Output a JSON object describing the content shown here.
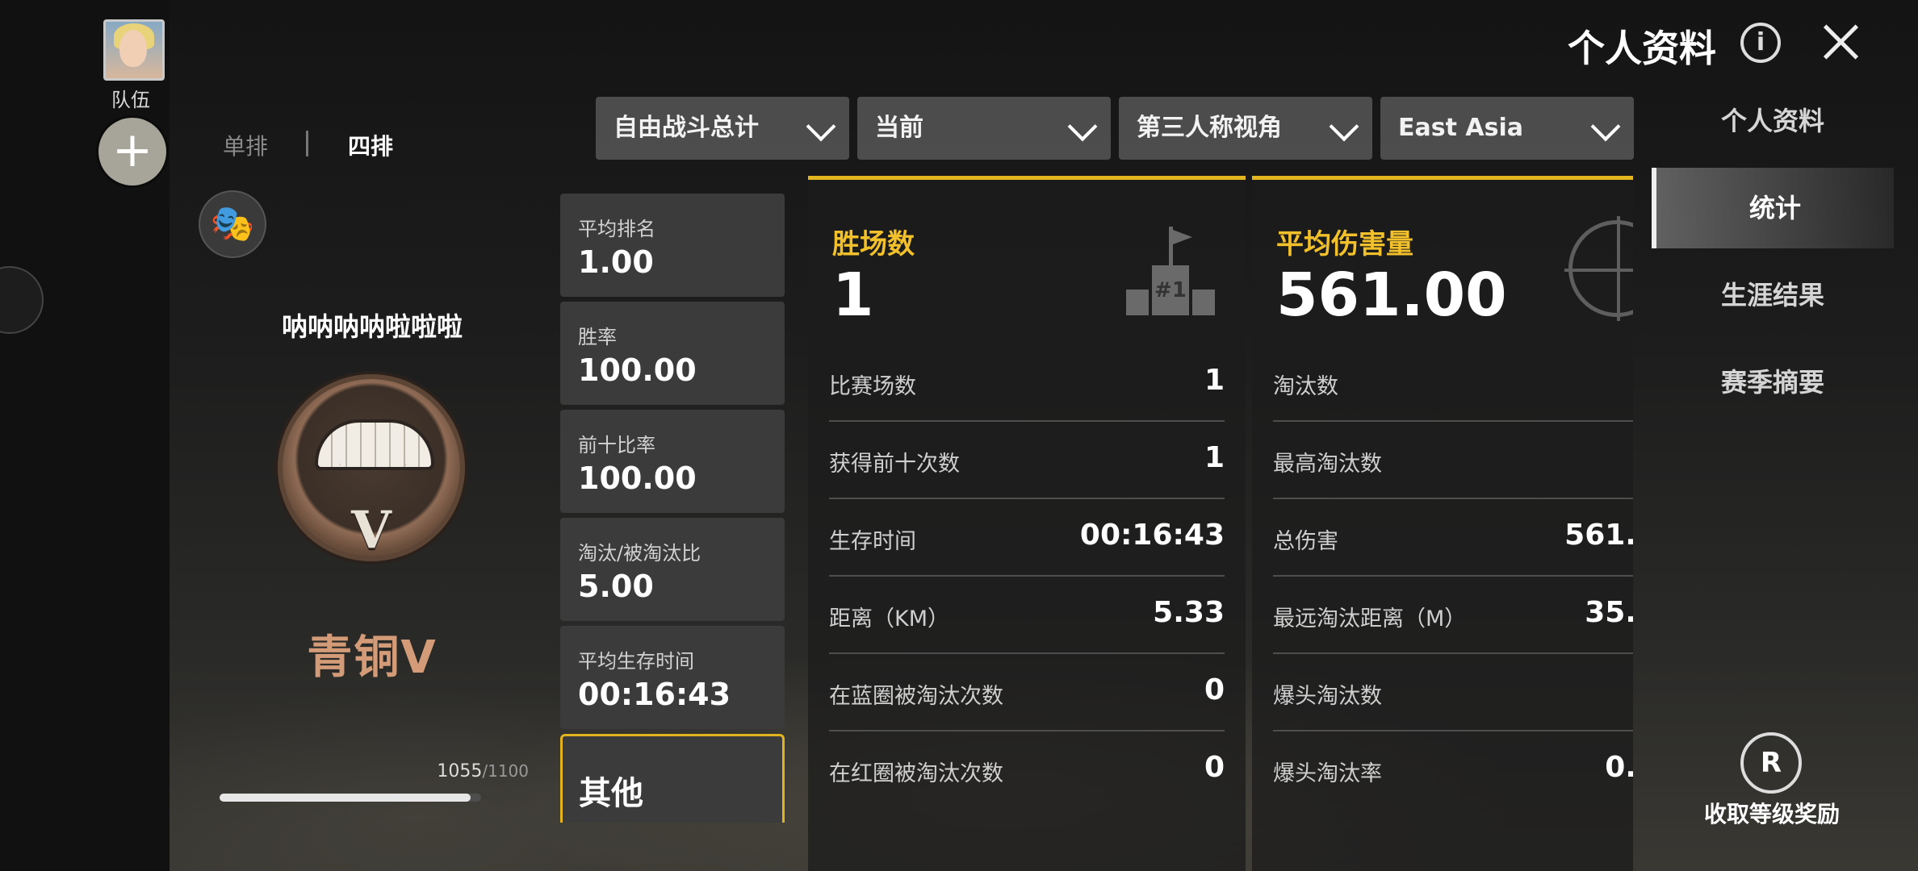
{
  "header": {
    "title": "个人资料",
    "info_icon": "i"
  },
  "left_bar": {
    "team_label": "队伍",
    "add_icon": "+"
  },
  "mode_tabs": {
    "solo": "单排",
    "squad": "四排",
    "selected": "四排"
  },
  "player": {
    "name": "呐呐呐呐啦啦啦",
    "rank_name": "青铜V",
    "rank_roman": "V",
    "xp_current": "1055",
    "xp_max": "/1100",
    "xp_progress": 0.959
  },
  "filters": [
    {
      "label": "自由战斗总计"
    },
    {
      "label": "当前"
    },
    {
      "label": "第三人称视角"
    },
    {
      "label": "East Asia"
    }
  ],
  "summary": [
    {
      "label": "平均排名",
      "value": "1.00"
    },
    {
      "label": "胜率",
      "value": "100.00"
    },
    {
      "label": "前十比率",
      "value": "100.00"
    },
    {
      "label": "淘汰/被淘汰比",
      "value": "5.00"
    },
    {
      "label": "平均生存时间",
      "value": "00:16:43"
    }
  ],
  "summary_other": "其他",
  "wins_panel": {
    "title": "胜场数",
    "big_value": "1",
    "badge": "#1",
    "rows": [
      {
        "label": "比赛场数",
        "value": "1"
      },
      {
        "label": "获得前十次数",
        "value": "1"
      },
      {
        "label": "生存时间",
        "value": "00:16:43"
      },
      {
        "label": "距离（KM）",
        "value": "5.33"
      },
      {
        "label": "在蓝圈被淘汰次数",
        "value": "0"
      },
      {
        "label": "在红圈被淘汰次数",
        "value": "0"
      }
    ]
  },
  "damage_panel": {
    "title": "平均伤害量",
    "big_value": "561.00",
    "rows": [
      {
        "label": "淘汰数",
        "value": ""
      },
      {
        "label": "最高淘汰数",
        "value": ""
      },
      {
        "label": "总伤害",
        "value": "561."
      },
      {
        "label": "最远淘汰距离（M）",
        "value": "35."
      },
      {
        "label": "爆头淘汰数",
        "value": ""
      },
      {
        "label": "爆头淘汰率",
        "value": "0."
      }
    ]
  },
  "side_nav": [
    {
      "label": "个人资料"
    },
    {
      "label": "统计"
    },
    {
      "label": "生涯结果"
    },
    {
      "label": "赛季摘要"
    }
  ],
  "reward": {
    "icon": "R",
    "label": "收取等级奖励"
  },
  "colors": {
    "accent": "#e3b51f",
    "rank": "#d39b77"
  }
}
